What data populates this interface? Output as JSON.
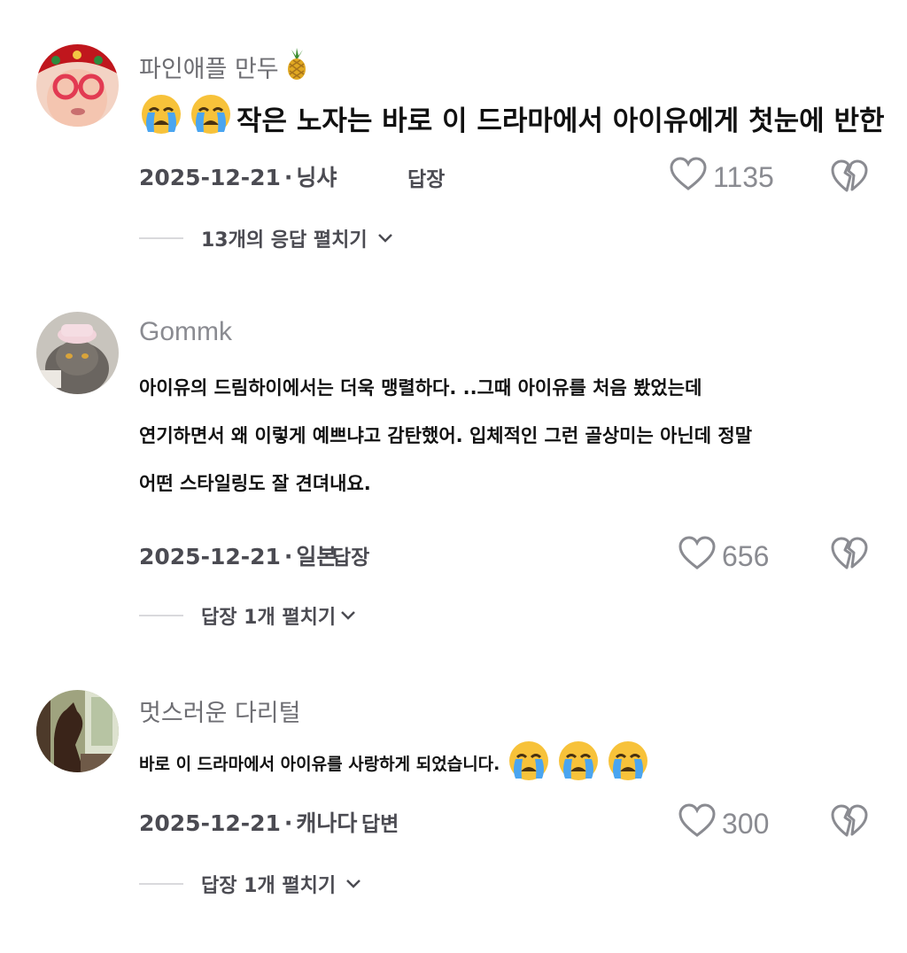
{
  "comments": [
    {
      "username": "파인애플 만두",
      "username_emoji": "pineapple-icon",
      "text": "작은 노자는 바로 이 드라마에서 아이유에게 첫눈에 반한",
      "leading_emoji": [
        "crying-face-icon",
        "crying-face-icon"
      ],
      "date": "2025-12-21",
      "location": "닝샤",
      "reply_label": "답장",
      "likes": "1135",
      "expand_label": "13개의 응답 펼치기"
    },
    {
      "username": "Gommk",
      "text_lines": [
        "아이유의 드림하이에서는 더욱 맹렬하다. ..그때 아이유를 처음 봤었는데",
        "연기하면서 왜 이렇게 예쁘냐고 감탄했어. 입체적인 그런 골상미는 아닌데 정말",
        "어떤 스타일링도 잘 견뎌내요."
      ],
      "date": "2025-12-21",
      "location": "일본",
      "reply_label": "답장",
      "likes": "656",
      "expand_label": "답장 1개 펼치기"
    },
    {
      "username": "멋스러운 다리털",
      "text": "바로 이 드라마에서 아이유를 사랑하게 되었습니다.",
      "trailing_emoji": [
        "crying-face-icon",
        "crying-face-icon",
        "crying-face-icon"
      ],
      "date": "2025-12-21",
      "location": "캐나다",
      "reply_label": "답변",
      "likes": "300",
      "expand_label": "답장 1개 펼치기"
    }
  ],
  "dot": "·",
  "colors": {
    "text_primary": "#111111",
    "text_secondary": "#4b4b52",
    "username": "#6e6e73",
    "icon_gray": "#8a8b91",
    "divider": "#d9d9dc"
  }
}
